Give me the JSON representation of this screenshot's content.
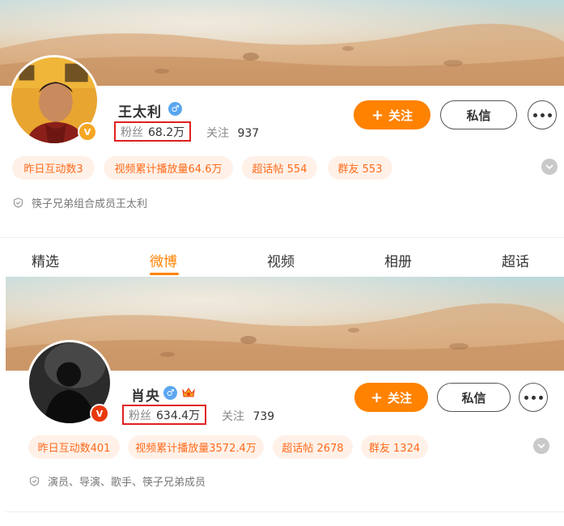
{
  "profiles": [
    {
      "name": "王太利",
      "fans_label": "粉丝",
      "fans_value": "68.2万",
      "following_label": "关注",
      "following_value": "937",
      "follow_button": "关注",
      "message_button": "私信",
      "stats": [
        {
          "label": "昨日互动数3"
        },
        {
          "label": "视频累计播放量64.6万"
        },
        {
          "label": "超话帖 554"
        },
        {
          "label": "群友 553"
        }
      ],
      "bio": "筷子兄弟组合成员王太利",
      "badge": "V"
    },
    {
      "name": "肖央",
      "fans_label": "粉丝",
      "fans_value": "634.4万",
      "following_label": "关注",
      "following_value": "739",
      "follow_button": "关注",
      "message_button": "私信",
      "stats": [
        {
          "label": "昨日互动数401"
        },
        {
          "label": "视频累计播放量3572.4万"
        },
        {
          "label": "超话帖 2678"
        },
        {
          "label": "群友 1324"
        }
      ],
      "bio": "演员、导演、歌手、筷子兄弟成员",
      "badge": "V"
    }
  ],
  "tabs": [
    {
      "label": "精选",
      "active": false
    },
    {
      "label": "微博",
      "active": true
    },
    {
      "label": "视频",
      "active": false
    },
    {
      "label": "相册",
      "active": false
    },
    {
      "label": "超话",
      "active": false
    }
  ],
  "colors": {
    "accent": "#ff8200",
    "highlight_box": "#e02020",
    "tag_bg": "#fff1e8",
    "tag_text": "#ff6a1a",
    "gender_icon": "#5aa6f0"
  },
  "icons": [
    "gender-male-icon",
    "vip-badge-icon",
    "crown-icon",
    "shield-icon",
    "chevron-down-icon",
    "more-dots-icon"
  ]
}
